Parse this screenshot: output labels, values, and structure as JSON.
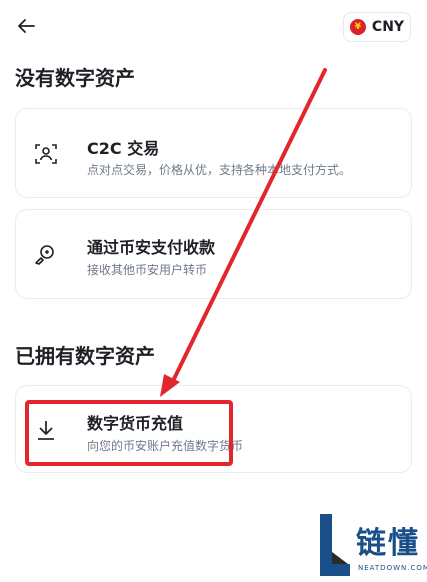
{
  "header": {
    "back_icon": "arrow-left-icon",
    "currency": {
      "code": "CNY",
      "flag_glyph": "¥",
      "flag_color": "#d8232a"
    }
  },
  "no_assets": {
    "title": "没有数字资产",
    "cards": [
      {
        "icon": "user-scan-icon",
        "title": "C2C 交易",
        "desc": "点对点交易，价格从优，支持各种本地支付方式。"
      },
      {
        "icon": "pay-receive-icon",
        "title": "通过币安支付收款",
        "desc": "接收其他币安用户转币"
      }
    ]
  },
  "has_assets": {
    "title": "已拥有数字资产",
    "cards": [
      {
        "icon": "download-icon",
        "title": "数字货币充值",
        "desc": "向您的币安账户充值数字货币"
      }
    ]
  },
  "annotation": {
    "color": "#e3262d"
  },
  "watermark": {
    "text": "链懂",
    "sub": "NEATDOWN.COM"
  }
}
